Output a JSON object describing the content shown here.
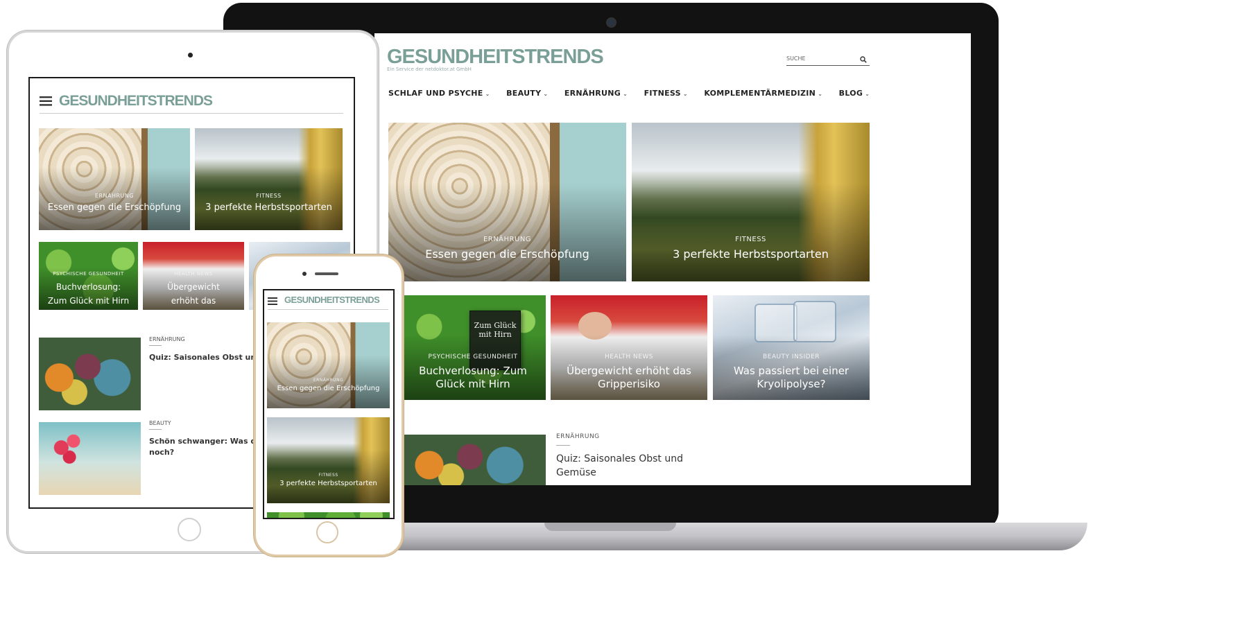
{
  "brand": {
    "name": "GESUNDHEITSTRENDS",
    "tagline": "Ein Service der netdoktor.at GmbH"
  },
  "search": {
    "placeholder": "SUCHE"
  },
  "nav": {
    "items": [
      {
        "label": "SCHLAF UND PSYCHE"
      },
      {
        "label": "BEAUTY"
      },
      {
        "label": "ERNÄHRUNG"
      },
      {
        "label": "FITNESS"
      },
      {
        "label": "KOMPLEMENTÄRMEDIZIN"
      },
      {
        "label": "BLOG"
      }
    ]
  },
  "featured": [
    {
      "category": "ERNÄHRUNG",
      "title": "Essen gegen die Erschöpfung"
    },
    {
      "category": "FITNESS",
      "title": "3 perfekte Herbstsportarten"
    }
  ],
  "secondary": [
    {
      "category": "PSYCHISCHE GESUNDHEIT",
      "title": "Buchverlosung: Zum Glück mit Hirn",
      "book": "Zum Glück mit Hirn"
    },
    {
      "category": "HEALTH NEWS",
      "title": "Übergewicht erhöht das Gripperisiko"
    },
    {
      "category": "BEAUTY INSIDER",
      "title": "Was passiert bei einer Kryolipolyse?"
    }
  ],
  "list": [
    {
      "category": "ERNÄHRUNG",
      "title": "Quiz: Saisonales Obst und Gemüse"
    }
  ],
  "tablet": {
    "secondary": [
      {
        "category": "PSYCHISCHE GESUNDHEIT",
        "title_lines": [
          "Buchverlosung:",
          "Zum Glück mit Hirn"
        ]
      },
      {
        "category": "HEALTH NEWS",
        "title_lines": [
          "Übergewicht",
          "erhöht das"
        ]
      }
    ],
    "list": [
      {
        "category": "ERNÄHRUNG",
        "title": "Quiz: Saisonales Obst und"
      },
      {
        "category": "BEAUTY",
        "title_lines": [
          "Schön schwanger: Was da",
          "noch?"
        ]
      }
    ]
  }
}
